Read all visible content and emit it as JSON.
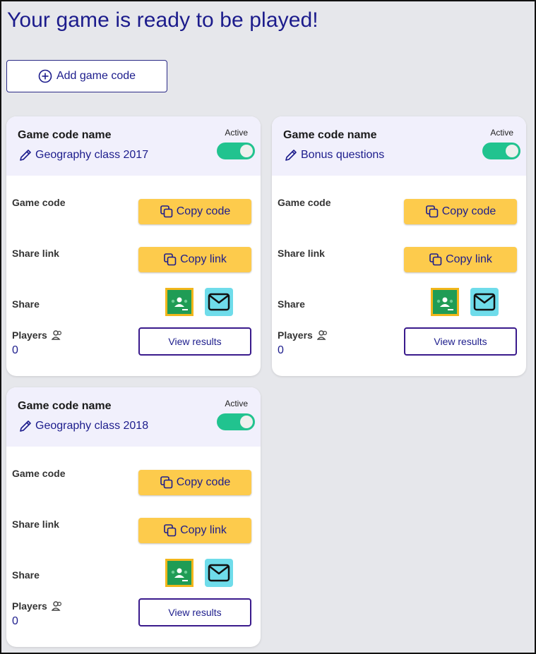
{
  "page": {
    "title": "Your game is ready to be played!",
    "add_button_label": "Add game code"
  },
  "labels": {
    "game_code_name": "Game code name",
    "active": "Active",
    "game_code": "Game code",
    "share_link": "Share link",
    "share": "Share",
    "players": "Players",
    "copy_code": "Copy code",
    "copy_link": "Copy link",
    "view_results": "View results"
  },
  "cards": [
    {
      "name": "Geography class 2017",
      "active": true,
      "players": "0"
    },
    {
      "name": "Bonus questions",
      "active": true,
      "players": "0"
    },
    {
      "name": "Geography class 2018",
      "active": true,
      "players": "0"
    }
  ],
  "icons": {
    "add": "plus-circle-icon",
    "edit": "pencil-icon",
    "copy": "copy-icon",
    "classroom": "google-classroom-icon",
    "email": "envelope-icon",
    "players": "users-icon"
  },
  "colors": {
    "primary_text": "#1c1c8c",
    "toggle_on": "#21c38f",
    "copy_button": "#fdcb4c",
    "email_bg": "#6fdcea",
    "classroom_green": "#1f9c55",
    "classroom_border": "#f1b61b",
    "page_bg": "#e6e7eb",
    "card_header_bg": "#f1f0fc"
  }
}
